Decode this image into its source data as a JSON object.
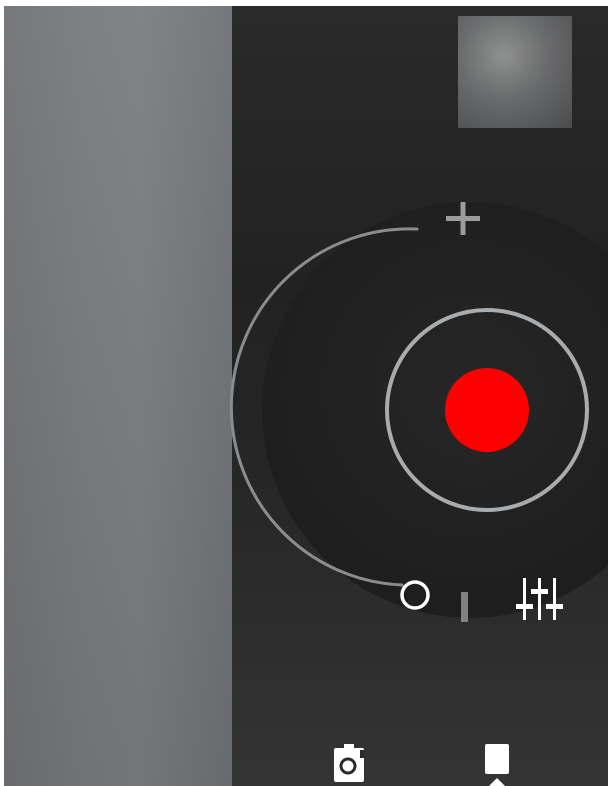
{
  "app": {
    "name": "Camera",
    "mode": "video"
  },
  "viewfinder": {
    "description_colors": {
      "preview_tone": "#76797c"
    }
  },
  "gallery_thumbnail": {
    "icon": "recent-media-thumbnail"
  },
  "zoom_control": {
    "plus_icon": "plus-icon",
    "handle_icon": "ring-handle-icon",
    "level": 0.0
  },
  "record_button": {
    "icon": "record-icon",
    "color": "#ff0000",
    "ring_color": "#a9acae"
  },
  "mode_indicator": {
    "icon": "bar-indicator-icon"
  },
  "settings_button": {
    "icon": "sliders-icon"
  },
  "bottom_bar": {
    "items": [
      {
        "icon": "switch-camera-icon"
      },
      {
        "icon": "mode-selector-icon"
      }
    ]
  }
}
